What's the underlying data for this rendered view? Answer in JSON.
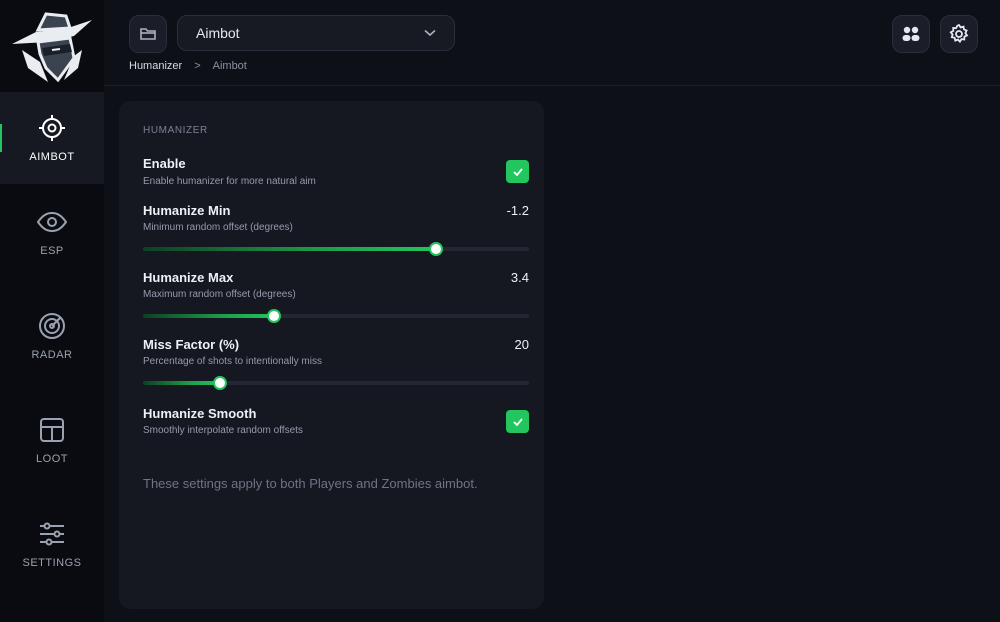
{
  "sidebar": {
    "items": [
      {
        "label": "AIMBOT",
        "icon": "crosshair-icon",
        "active": true
      },
      {
        "label": "ESP",
        "icon": "eye-icon",
        "active": false
      },
      {
        "label": "RADAR",
        "icon": "radar-icon",
        "active": false
      },
      {
        "label": "LOOT",
        "icon": "layout-icon",
        "active": false
      },
      {
        "label": "SETTINGS",
        "icon": "sliders-icon",
        "active": false
      }
    ]
  },
  "header": {
    "dropdown_value": "Aimbot",
    "breadcrumb": [
      "Humanizer",
      ">",
      "Aimbot"
    ]
  },
  "panel": {
    "section_title": "HUMANIZER",
    "settings": {
      "enable": {
        "label": "Enable",
        "desc": "Enable humanizer for more natural aim",
        "checked": true
      },
      "humanize_min": {
        "label": "Humanize Min",
        "desc": "Minimum random offset (degrees)",
        "value": "-1.2",
        "fill": 0.76
      },
      "humanize_max": {
        "label": "Humanize Max",
        "desc": "Maximum random offset (degrees)",
        "value": "3.4",
        "fill": 0.34
      },
      "miss_factor": {
        "label": "Miss Factor (%)",
        "desc": "Percentage of shots to intentionally miss",
        "value": "20",
        "fill": 0.2
      },
      "humanize_smooth": {
        "label": "Humanize Smooth",
        "desc": "Smoothly interpolate random offsets",
        "checked": true
      }
    },
    "note": "These settings apply to both Players and Zombies aimbot."
  },
  "colors": {
    "accent": "#22c55e",
    "background": "#0e1017",
    "panel": "#151821",
    "sidebar": "#090b10"
  }
}
